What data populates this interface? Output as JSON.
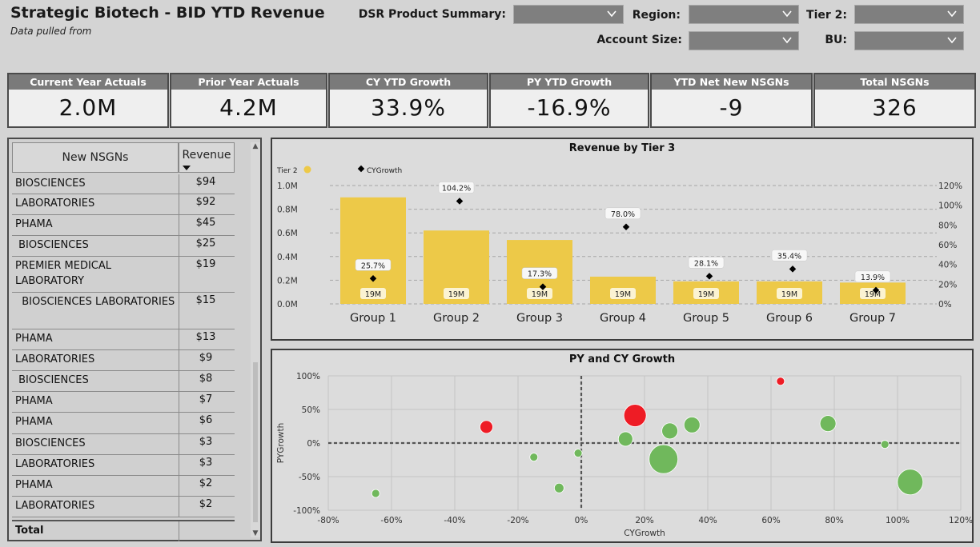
{
  "header": {
    "title": "Strategic Biotech - BID YTD Revenue",
    "subtitle": "Data pulled from"
  },
  "filters": {
    "dsr_label": "DSR Product Summary:",
    "region_label": "Region:",
    "tier2_label": "Tier 2:",
    "account_size_label": "Account Size:",
    "bu_label": "BU:"
  },
  "kpis": [
    {
      "label": "Current Year Actuals",
      "value": "2.0M"
    },
    {
      "label": "Prior Year Actuals",
      "value": "4.2M"
    },
    {
      "label": "CY YTD Growth",
      "value": "33.9%"
    },
    {
      "label": "PY YTD Growth",
      "value": "-16.9%"
    },
    {
      "label": "YTD Net New NSGNs",
      "value": "-9"
    },
    {
      "label": "Total NSGNs",
      "value": "326"
    }
  ],
  "table": {
    "col_name": "New NSGNs",
    "col_revenue": "Revenue",
    "total_label": "Total",
    "rows": [
      {
        "name": "BIOSCIENCES",
        "rev": "$94"
      },
      {
        "name": "LABORATORIES",
        "rev": "$92"
      },
      {
        "name": "PHAMA",
        "rev": "$45"
      },
      {
        "name": " BIOSCIENCES",
        "rev": "$25"
      },
      {
        "name": "PREMIER MEDICAL LABORATORY",
        "rev": "$19"
      },
      {
        "name": "  BIOSCIENCES LABORATORIES",
        "rev": "$15"
      },
      {
        "name": "PHAMA",
        "rev": "$13"
      },
      {
        "name": "LABORATORIES",
        "rev": "$9"
      },
      {
        "name": " BIOSCIENCES",
        "rev": "$8"
      },
      {
        "name": "PHAMA",
        "rev": "$7"
      },
      {
        "name": "PHAMA",
        "rev": "$6"
      },
      {
        "name": "BIOSCIENCES",
        "rev": "$3"
      },
      {
        "name": "LABORATORIES",
        "rev": "$3"
      },
      {
        "name": "PHAMA",
        "rev": "$2"
      },
      {
        "name": "LABORATORIES",
        "rev": "$2"
      }
    ]
  },
  "chart_data": [
    {
      "type": "bar",
      "title": "Revenue by Tier 3",
      "legend": [
        "Tier 2",
        "CYGrowth"
      ],
      "categories": [
        "Group 1",
        "Group 2",
        "Group 3",
        "Group 4",
        "Group 5",
        "Group 6",
        "Group 7"
      ],
      "values": [
        0.9,
        0.62,
        0.54,
        0.23,
        0.19,
        0.19,
        0.18
      ],
      "bar_labels": [
        "19M",
        "19M",
        "19M",
        "19M",
        "19M",
        "19M",
        "19M"
      ],
      "growth": [
        25.7,
        104.2,
        17.3,
        78.0,
        28.1,
        35.4,
        13.9
      ],
      "growth_labels": [
        "25.7%",
        "104.2%",
        "17.3%",
        "78.0%",
        "28.1%",
        "35.4%",
        "13.9%"
      ],
      "y_ticks": [
        "0.0M",
        "0.2M",
        "0.4M",
        "0.6M",
        "0.8M",
        "1.0M"
      ],
      "y2_ticks": [
        "0%",
        "20%",
        "40%",
        "60%",
        "80%",
        "100%",
        "120%"
      ],
      "ylim": [
        0,
        1.0
      ],
      "y2lim": [
        0,
        120
      ],
      "bar_color": "#edc948",
      "marker_color": "#000000"
    },
    {
      "type": "scatter",
      "title": "PY and CY Growth",
      "xlabel": "CYGrowth",
      "ylabel": "PYGrowth",
      "xlim": [
        -80,
        120
      ],
      "ylim": [
        -100,
        100
      ],
      "x_ticks": [
        "-80%",
        "-60%",
        "-40%",
        "-20%",
        "0%",
        "20%",
        "40%",
        "60%",
        "80%",
        "100%",
        "120%"
      ],
      "y_ticks": [
        "100%",
        "50%",
        "0%",
        "-50%",
        "-100%"
      ],
      "points": [
        {
          "x": -65,
          "y": -75,
          "r": 5,
          "color": "#70b85c"
        },
        {
          "x": -30,
          "y": 24,
          "r": 8,
          "color": "#ee1c25"
        },
        {
          "x": -15,
          "y": -21,
          "r": 5,
          "color": "#70b85c"
        },
        {
          "x": -7,
          "y": -67,
          "r": 6,
          "color": "#70b85c"
        },
        {
          "x": -1,
          "y": -15,
          "r": 5,
          "color": "#70b85c"
        },
        {
          "x": 14,
          "y": 6,
          "r": 9,
          "color": "#70b85c"
        },
        {
          "x": 17,
          "y": 41,
          "r": 14,
          "color": "#ee1c25"
        },
        {
          "x": 26,
          "y": -24,
          "r": 18,
          "color": "#70b85c"
        },
        {
          "x": 28,
          "y": 18,
          "r": 10,
          "color": "#70b85c"
        },
        {
          "x": 35,
          "y": 27,
          "r": 10,
          "color": "#70b85c"
        },
        {
          "x": 63,
          "y": 92,
          "r": 5,
          "color": "#ee1c25"
        },
        {
          "x": 78,
          "y": 29,
          "r": 10,
          "color": "#70b85c"
        },
        {
          "x": 96,
          "y": -2,
          "r": 5,
          "color": "#70b85c"
        },
        {
          "x": 104,
          "y": -58,
          "r": 16,
          "color": "#70b85c"
        }
      ]
    }
  ]
}
